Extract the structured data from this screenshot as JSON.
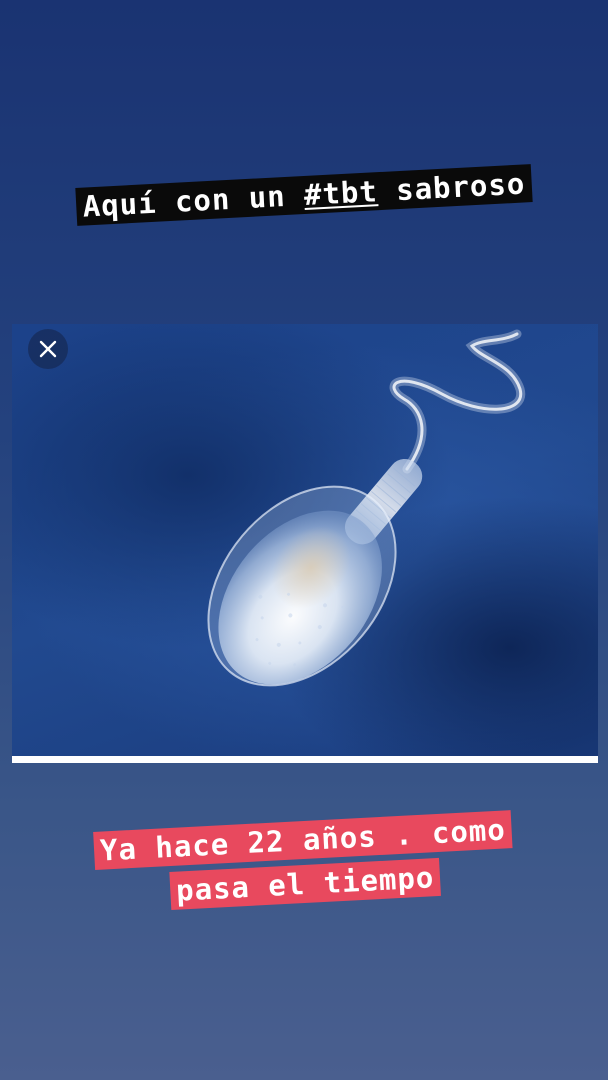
{
  "story": {
    "top_caption": {
      "before": "Aquí con un ",
      "hashtag": "#tbt",
      "after": " sabroso"
    },
    "bottom_caption": {
      "line1": "Ya hace 22 años . como",
      "line2": "pasa el tiempo"
    }
  },
  "photo": {
    "subject": "sperm-cell-illustration"
  },
  "controls": {
    "close_icon": "close-icon"
  },
  "colors": {
    "background_top": "#1a3372",
    "background_bottom": "#4a5f8f",
    "caption_black": "#0a0a0a",
    "caption_red": "#e8495e",
    "text_white": "#ffffff"
  }
}
